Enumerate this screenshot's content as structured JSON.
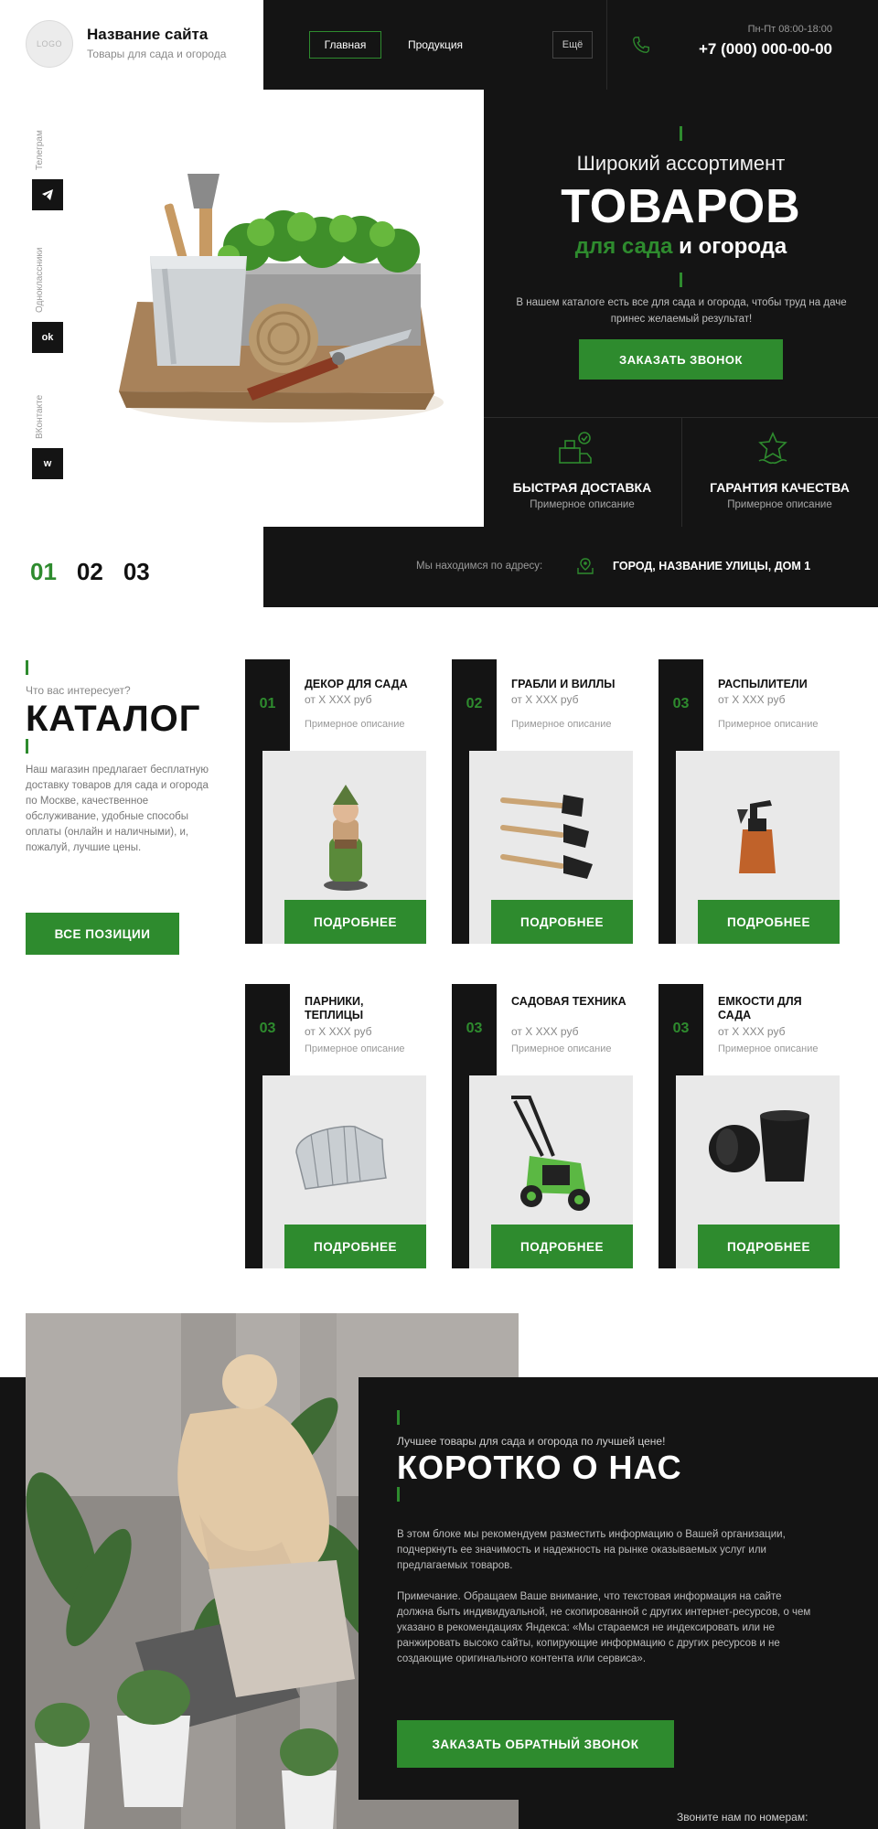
{
  "header": {
    "logo_text": "LOGO",
    "site_name": "Название сайта",
    "tagline": "Товары для сада и огорода",
    "nav": {
      "main": "Главная",
      "products": "Продукция",
      "more": "Ещё"
    },
    "work_hours": "Пн-Пт 08:00-18:00",
    "phone": "+7 (000) 000-00-00"
  },
  "social": {
    "telegram": "Телеграм",
    "odnoklassniki": "Одноклассники",
    "ok_label": "ok",
    "vkontakte": "ВКонтакте",
    "vk_label": "ᴡ"
  },
  "hero": {
    "subtitle": "Широкий ассортимент",
    "title": "ТОВАРОВ",
    "line3_green": "для сада",
    "line3_white": " и огорода",
    "description": "В нашем каталоге есть все для сада и огорода, чтобы труд на даче принес желаемый результат!",
    "cta": "ЗАКАЗАТЬ ЗВОНОК",
    "features": [
      {
        "title": "БЫСТРАЯ ДОСТАВКА",
        "desc": "Примерное описание",
        "icon": "delivery-icon"
      },
      {
        "title": "ГАРАНТИЯ КАЧЕСТВА",
        "desc": "Примерное описание",
        "icon": "quality-icon"
      }
    ]
  },
  "slider": {
    "numbers": [
      "01",
      "02",
      "03"
    ],
    "active": 0
  },
  "address": {
    "label": "Мы находимся по адресу:",
    "value": "ГОРОД, НАЗВАНИЕ УЛИЦЫ, ДОМ 1"
  },
  "catalog": {
    "kicker": "Что вас интересует?",
    "title": "КАТАЛОГ",
    "description": "Наш магазин предлагает бесплатную доставку товаров для сада и огорода по Москве, качественное обслуживание, удобные способы оплаты (онлайн и наличными), и, пожалуй, лучшие цены.",
    "all_button": "ВСЕ ПОЗИЦИИ",
    "cards": [
      {
        "num": "01",
        "title": "ДЕКОР ДЛЯ САДА",
        "price": "от X XXX руб",
        "desc": "Примерное описание",
        "button": "ПОДРОБНЕЕ"
      },
      {
        "num": "02",
        "title": "ГРАБЛИ И ВИЛЛЫ",
        "price": "от X XXX руб",
        "desc": "Примерное описание",
        "button": "ПОДРОБНЕЕ"
      },
      {
        "num": "03",
        "title": "РАСПЫЛИТЕЛИ",
        "price": "от X XXX руб",
        "desc": "Примерное описание",
        "button": "ПОДРОБНЕЕ"
      },
      {
        "num": "03",
        "title": "ПАРНИКИ, ТЕПЛИЦЫ",
        "price": "от X XXX руб",
        "desc": "Примерное описание",
        "button": "ПОДРОБНЕЕ"
      },
      {
        "num": "03",
        "title": "САДОВАЯ ТЕХНИКА",
        "price": "от X XXX руб",
        "desc": "Примерное описание",
        "button": "ПОДРОБНЕЕ"
      },
      {
        "num": "03",
        "title": "ЕМКОСТИ ДЛЯ САДА",
        "price": "от X XXX руб",
        "desc": "Примерное описание",
        "button": "ПОДРОБНЕЕ"
      }
    ]
  },
  "about": {
    "kicker": "Лучшее товары для сада и огорода по лучшей цене!",
    "title": "КОРОТКО О НАС",
    "p1": "В этом блоке мы рекомендуем разместить информацию о Вашей организации, подчеркнуть ее значимость и надежность на рынке оказываемых услуг или предлагаемых товаров.",
    "p2": "Примечание. Обращаем Ваше внимание, что текстовая информация на сайте должна быть индивидуальной, не скопированной с других интернет-ресурсов, о чем указано в рекомендациях Яндекса: «Мы стараемся не индексировать или не ранжировать высоко сайты, копирующие информацию с других ресурсов и не создающие оригинального контента или сервиса».",
    "cta": "ЗАКАЗАТЬ ОБРАТНЫЙ ЗВОНОК",
    "call_us": "Звоните нам по номерам:"
  },
  "colors": {
    "accent": "#2e8b2e",
    "dark": "#141414"
  }
}
